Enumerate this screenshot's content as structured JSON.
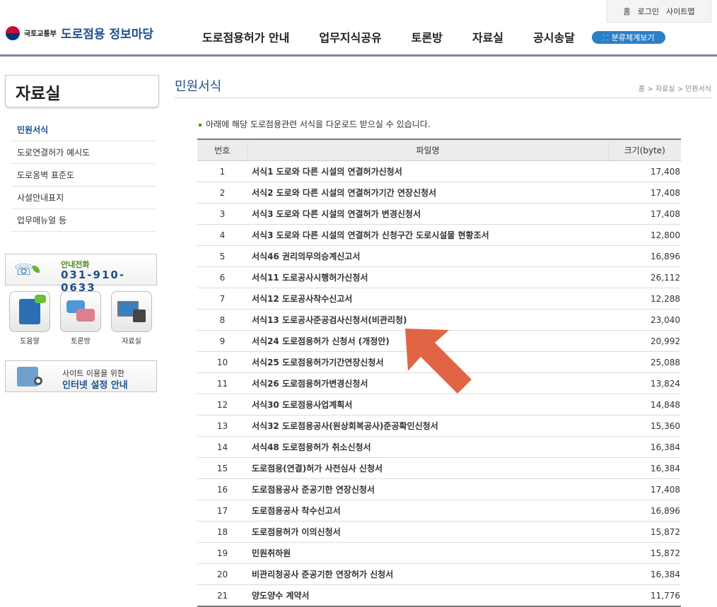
{
  "util_links": [
    "홈",
    "로그인",
    "사이트맵"
  ],
  "logo": {
    "ministry": "국토교통부",
    "site": "도로점용 정보마당"
  },
  "gnb": [
    "도로점용허가 안내",
    "업무지식공유",
    "토론방",
    "자료실",
    "공시송달"
  ],
  "category_button": "분류체계보기",
  "side": {
    "title": "자료실",
    "menu": [
      "민원서식",
      "도로연결허가 예시도",
      "도로옹벽 표준도",
      "사설안내표지",
      "업무매뉴얼 등"
    ],
    "call": {
      "label": "안내전화",
      "number": "031-910-0633"
    },
    "quick": [
      "도움말",
      "토론방",
      "자료실"
    ],
    "net": {
      "line1": "사이트 이용을 위한",
      "line2": "인터넷 설정 안내"
    }
  },
  "page": {
    "title": "민원서식",
    "breadcrumb": "홈 > 자료실 > 민원서식",
    "intro": "아래에 해당 도로점용관련 서식을 다운로드 받으실 수 있습니다."
  },
  "table": {
    "headers": [
      "번호",
      "파일명",
      "크기(byte)"
    ],
    "rows": [
      {
        "no": "1",
        "name": "서식1 도로와 다른 시설의 연결허가신청서",
        "size": "17,408"
      },
      {
        "no": "2",
        "name": "서식2 도로와 다른 시설의 연결허가기간 연장신청서",
        "size": "17,408"
      },
      {
        "no": "3",
        "name": "서식3 도로와 다른 시설의 연결허가 변경신청서",
        "size": "17,408"
      },
      {
        "no": "4",
        "name": "서식3 도로와 다른 시설의 연결허가 신청구간 도로시설물 현황조서",
        "size": "12,800"
      },
      {
        "no": "5",
        "name": "서식46 권리의무의승계신고서",
        "size": "16,896"
      },
      {
        "no": "6",
        "name": "서식11 도로공사시행허가신청서",
        "size": "26,112"
      },
      {
        "no": "7",
        "name": "서식12 도로공사착수신고서",
        "size": "12,288"
      },
      {
        "no": "8",
        "name": "서식13 도로공사준공검사신청서(비관리청)",
        "size": "23,040"
      },
      {
        "no": "9",
        "name": "서식24 도로점용허가 신청서 (개정안)",
        "size": "20,992"
      },
      {
        "no": "10",
        "name": "서식25 도로점용허가기간연장신청서",
        "size": "25,088"
      },
      {
        "no": "11",
        "name": "서식26 도로점용허가변경신청서",
        "size": "13,824"
      },
      {
        "no": "12",
        "name": "서식30 도로점용사업계획서",
        "size": "14,848"
      },
      {
        "no": "13",
        "name": "서식32 도로점용공사(원상회복공사)준공확인신청서",
        "size": "15,360"
      },
      {
        "no": "14",
        "name": "서식48 도로점용허가 취소신청서",
        "size": "16,384"
      },
      {
        "no": "15",
        "name": "도로점용(연결)허가 사전심사 신청서",
        "size": "16,384"
      },
      {
        "no": "16",
        "name": "도로점용공사 준공기한 연장신청서",
        "size": "17,408"
      },
      {
        "no": "17",
        "name": "도로점용공사 착수신고서",
        "size": "16,896"
      },
      {
        "no": "18",
        "name": "도로점용허가 이의신청서",
        "size": "15,872"
      },
      {
        "no": "19",
        "name": "민원취하원",
        "size": "15,872"
      },
      {
        "no": "20",
        "name": "비관리청공사 준공기한 연장허가 신청서",
        "size": "16,384"
      },
      {
        "no": "21",
        "name": "양도양수 계약서",
        "size": "11,776"
      }
    ]
  },
  "colors": {
    "brand": "#1d4f8f",
    "arrow": "#e06545",
    "accent_green": "#4a9a2a"
  }
}
